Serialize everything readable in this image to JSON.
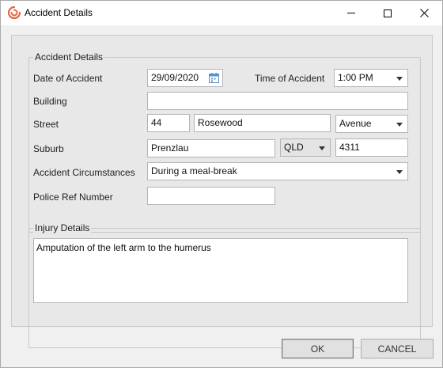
{
  "window": {
    "title": "Accident Details",
    "icon": "swirl-logo-icon",
    "brand_color": "#e8643c"
  },
  "accident_section": {
    "legend": "Accident Details",
    "date_label": "Date of Accident",
    "date_value": "29/09/2020",
    "time_label": "Time of Accident",
    "time_value": "1:00 PM",
    "building_label": "Building",
    "building_value": "",
    "street_label": "Street",
    "street_number": "44",
    "street_name": "Rosewood",
    "street_type": "Avenue",
    "suburb_label": "Suburb",
    "suburb_value": "Prenzlau",
    "state_value": "QLD",
    "postcode_value": "4311",
    "circumstances_label": "Accident Circumstances",
    "circumstances_value": "During a meal-break",
    "police_ref_label": "Police Ref Number",
    "police_ref_value": ""
  },
  "injury_section": {
    "legend": "Injury Details",
    "details_value": "Amputation of the left arm to the humerus"
  },
  "footer": {
    "ok_label": "OK",
    "cancel_label": "CANCEL"
  }
}
